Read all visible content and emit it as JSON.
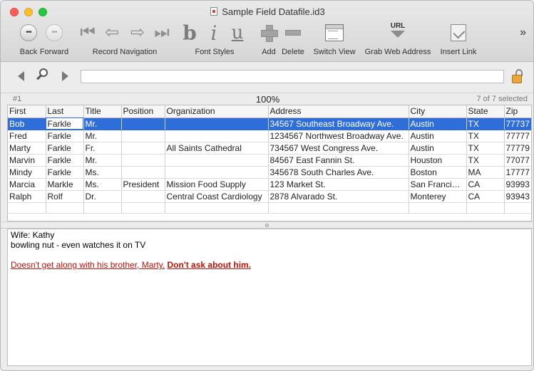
{
  "window": {
    "title": "Sample Field Datafile.id3"
  },
  "toolbar": {
    "back_label": "Back",
    "forward_label": "Forward",
    "back_glyph": "•••",
    "forward_glyph": "•••",
    "record_navigation_label": "Record Navigation",
    "font_styles_label": "Font Styles",
    "add_label": "Add",
    "delete_label": "Delete",
    "switch_view_label": "Switch View",
    "grab_web_address_label": "Grab Web Address",
    "insert_link_label": "Insert Link",
    "url_icon_text": "URL",
    "overflow": "»",
    "font_b": "b",
    "font_i": "i",
    "font_u": "u"
  },
  "search": {
    "value": "",
    "placeholder": ""
  },
  "status": {
    "record": "#1",
    "zoom": "100%",
    "selection": "7 of 7 selected"
  },
  "table": {
    "columns": [
      "First",
      "Last",
      "Title",
      "Position",
      "Organization",
      "Address",
      "City",
      "State",
      "Zip"
    ],
    "rows": [
      [
        "Bob",
        "Farkle",
        "Mr.",
        "",
        "",
        "34567 Southeast Broadway Ave.",
        "Austin",
        "TX",
        "77737"
      ],
      [
        "Fred",
        "Farkle",
        "Mr.",
        "",
        "",
        "1234567 Northwest Broadway Ave.",
        "Austin",
        "TX",
        "77777"
      ],
      [
        "Marty",
        "Farkle",
        "Fr.",
        "",
        "All Saints Cathedral",
        "734567 West Congress Ave.",
        "Austin",
        "TX",
        "77779"
      ],
      [
        "Marvin",
        "Farkle",
        "Mr.",
        "",
        "",
        "84567 East Fannin St.",
        "Houston",
        "TX",
        "77077"
      ],
      [
        "Mindy",
        "Farkle",
        "Ms.",
        "",
        "",
        "345678 South Charles Ave.",
        "Boston",
        "MA",
        "17777"
      ],
      [
        "Marcia",
        "Markle",
        "Ms.",
        "President",
        "Mission Food Supply",
        "123 Market St.",
        "San Francisco",
        "CA",
        "93993"
      ],
      [
        "Ralph",
        "Rolf",
        "Dr.",
        "",
        "Central Coast Cardiology",
        "2878 Alvarado St.",
        "Monterey",
        "CA",
        "93943"
      ]
    ]
  },
  "notes": {
    "line1": "Wife: Kathy",
    "line2": "bowling nut - even watches it on TV",
    "line3_part1": "Doesn't get along with his brother, Marty.",
    "line3_part2": "Don't ask about him."
  },
  "colors": {
    "selection": "#2f6ed8",
    "note_red": "#b5150b",
    "lock": "#e8a53b"
  }
}
